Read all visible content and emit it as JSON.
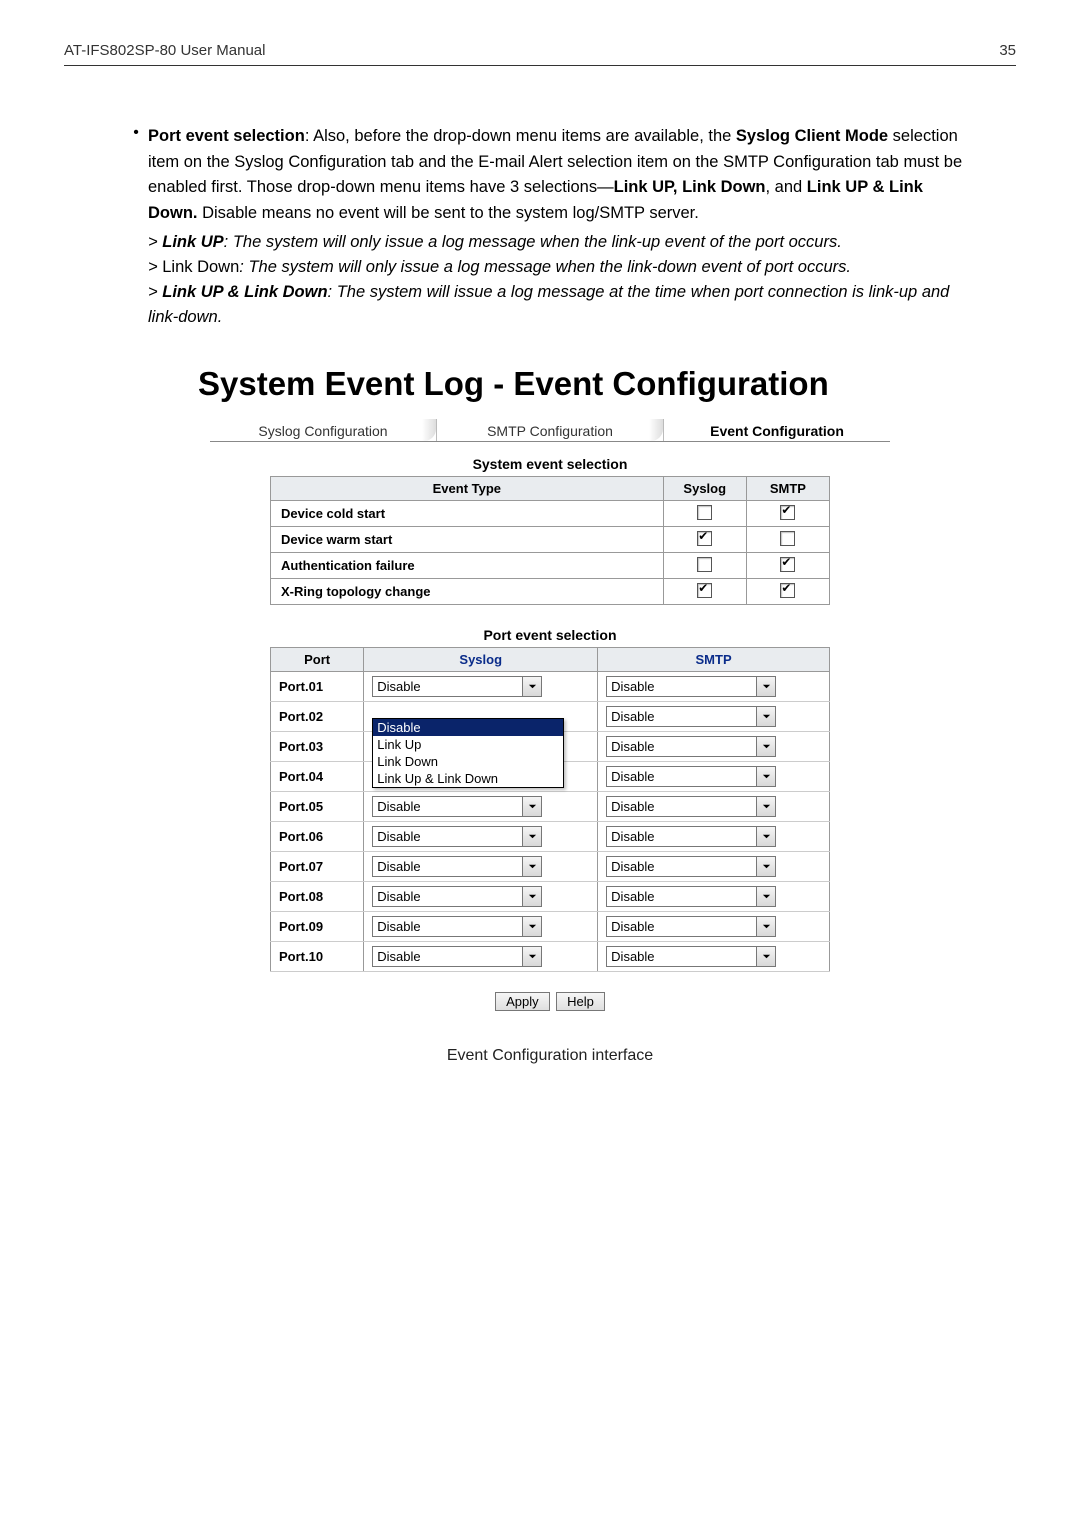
{
  "header": {
    "left": "AT-IFS802SP-80 User Manual",
    "right": "35"
  },
  "para": {
    "lead_bold": "Port event selection",
    "lead_rest": ": Also, before the drop-down menu items are available, the ",
    "lead_bold2": "Syslog Client Mode",
    "lead_rest2": " selection item on the Syslog Configuration tab and the E-mail Alert selection item on the SMTP Configuration tab must be enabled first. Those drop-down menu items have 3 selections—",
    "lead_bold3": "Link UP, Link Down",
    "lead_rest3": ", and ",
    "lead_bold4": "Link UP & Link Down.",
    "lead_rest4": " Disable means no event will be sent to the system log/SMTP server.",
    "s1_b": "Link UP",
    "s1_r": ": The system will only issue a log message when the link-up event of the port occurs.",
    "s2_b": "Link Down",
    "s2_r": ": The system will only issue a log message when the link-down event of port occurs.",
    "s3_b": "Link UP & Link Down",
    "s3_r": ": The system will issue a log message at the time when port connection is link-up and link-down."
  },
  "title": "System Event Log - Event Configuration",
  "tabs": {
    "t1": "Syslog Configuration",
    "t2": "SMTP Configuration",
    "t3": "Event Configuration"
  },
  "sys": {
    "title": "System event selection",
    "h1": "Event Type",
    "h2": "Syslog",
    "h3": "SMTP",
    "rows": [
      {
        "name": "Device cold start",
        "syslog": false,
        "smtp": true
      },
      {
        "name": "Device warm start",
        "syslog": true,
        "smtp": false
      },
      {
        "name": "Authentication failure",
        "syslog": false,
        "smtp": true
      },
      {
        "name": "X-Ring topology change",
        "syslog": true,
        "smtp": true
      }
    ]
  },
  "port": {
    "title": "Port event selection",
    "h1": "Port",
    "h2": "Syslog",
    "h3": "SMTP",
    "options": [
      "Disable",
      "Link Up",
      "Link Down",
      "Link Up & Link Down"
    ],
    "rows": [
      {
        "name": "Port.01",
        "syslog": "Disable",
        "smtp": "Disable",
        "open": false
      },
      {
        "name": "Port.02",
        "syslog": "Disable",
        "smtp": "Disable",
        "open": true
      },
      {
        "name": "Port.03",
        "syslog": "Disable",
        "smtp": "Disable",
        "open": false
      },
      {
        "name": "Port.04",
        "syslog": "Disable",
        "smtp": "Disable",
        "open": false
      },
      {
        "name": "Port.05",
        "syslog": "Disable",
        "smtp": "Disable",
        "open": false
      },
      {
        "name": "Port.06",
        "syslog": "Disable",
        "smtp": "Disable",
        "open": false
      },
      {
        "name": "Port.07",
        "syslog": "Disable",
        "smtp": "Disable",
        "open": false
      },
      {
        "name": "Port.08",
        "syslog": "Disable",
        "smtp": "Disable",
        "open": false
      },
      {
        "name": "Port.09",
        "syslog": "Disable",
        "smtp": "Disable",
        "open": false
      },
      {
        "name": "Port.10",
        "syslog": "Disable",
        "smtp": "Disable",
        "open": false
      }
    ]
  },
  "buttons": {
    "apply": "Apply",
    "help": "Help"
  },
  "caption": "Event Configuration interface"
}
